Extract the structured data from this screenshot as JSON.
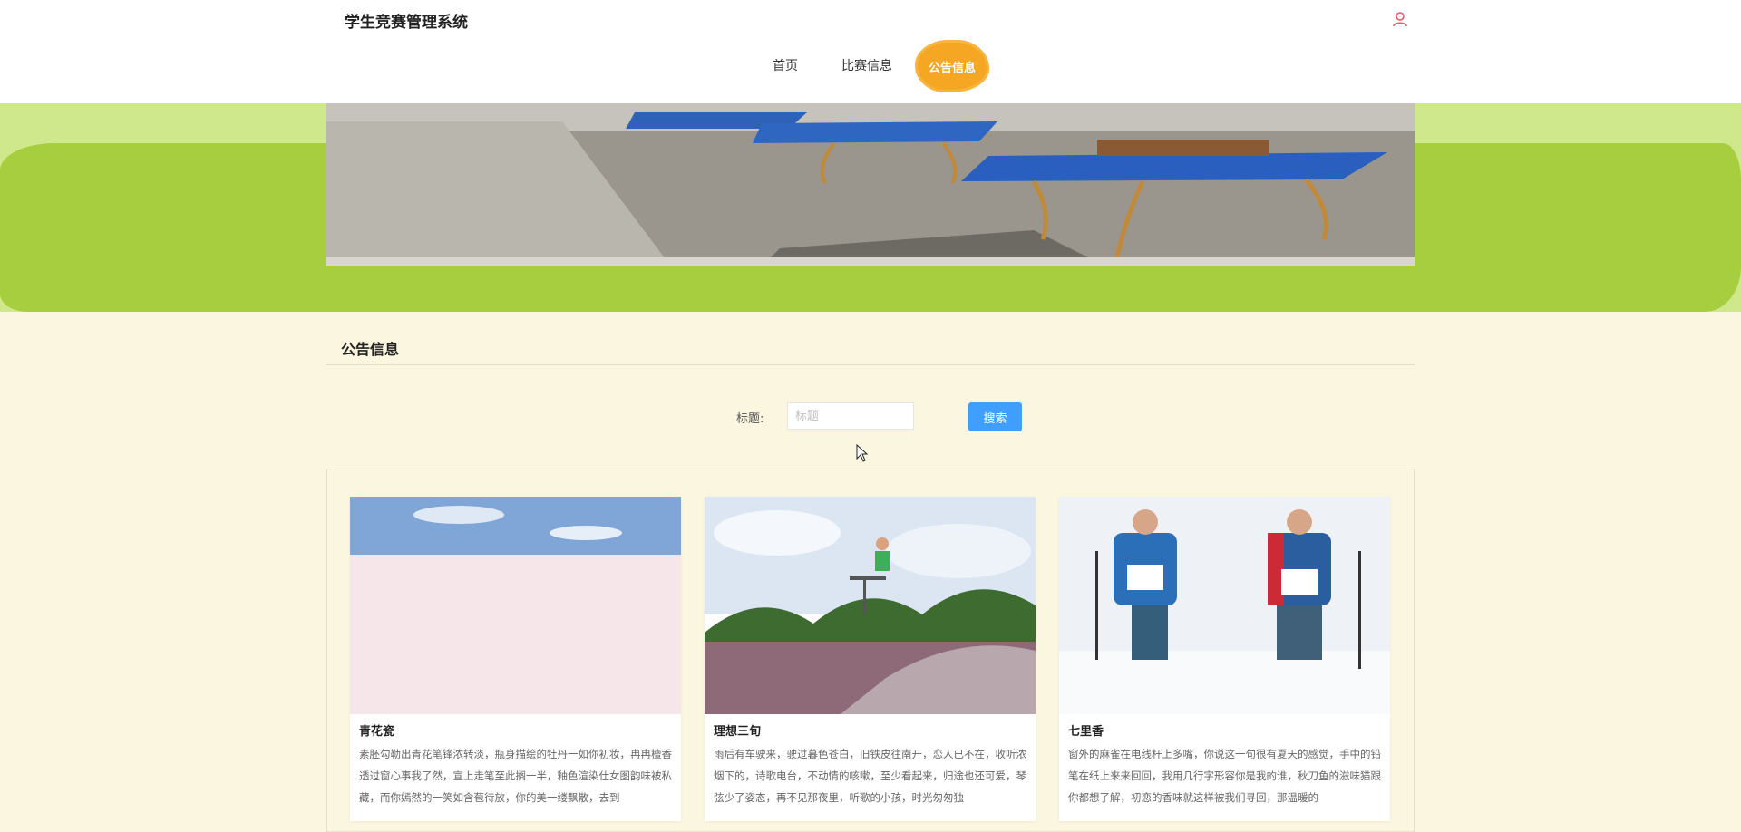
{
  "app": {
    "title": "学生竞赛管理系统"
  },
  "nav": {
    "items": [
      {
        "label": "首页"
      },
      {
        "label": "比赛信息"
      },
      {
        "label": "公告信息",
        "active": true
      }
    ]
  },
  "section": {
    "title": "公告信息"
  },
  "search": {
    "label": "标题:",
    "placeholder": "标题",
    "value": "",
    "button_label": "搜索"
  },
  "cards": [
    {
      "title": "青花瓷",
      "text": "素胚勾勒出青花笔锋浓转淡，瓶身描绘的牡丹一如你初妆，冉冉檀香透过窗心事我了然，宣上走笔至此搁一半，釉色渲染仕女图韵味被私藏，而你嫣然的一笑如含苞待放，你的美一缕飘散，去到"
    },
    {
      "title": "理想三旬",
      "text": "雨后有车驶来，驶过暮色苍白，旧铁皮往南开，恋人已不在，收听浓烟下的，诗歌电台，不动情的咳嗽，至少看起来，归途也还可爱，琴弦少了姿态，再不见那夜里，听歌的小孩，时光匆匆独"
    },
    {
      "title": "七里香",
      "text": "窗外的麻雀在电线杆上多嘴，你说这一句很有夏天的感觉，手中的铅笔在纸上来来回回，我用几行字形容你是我的谁，秋刀鱼的滋味猫跟你都想了解，初恋的香味就这样被我们寻回，那温暖的"
    }
  ],
  "colors": {
    "accent": "#f5a623",
    "button": "#409eff",
    "banner_green": "#a6ce3f",
    "page_bg": "#fbf6df",
    "user_icon": "#e0566a"
  }
}
